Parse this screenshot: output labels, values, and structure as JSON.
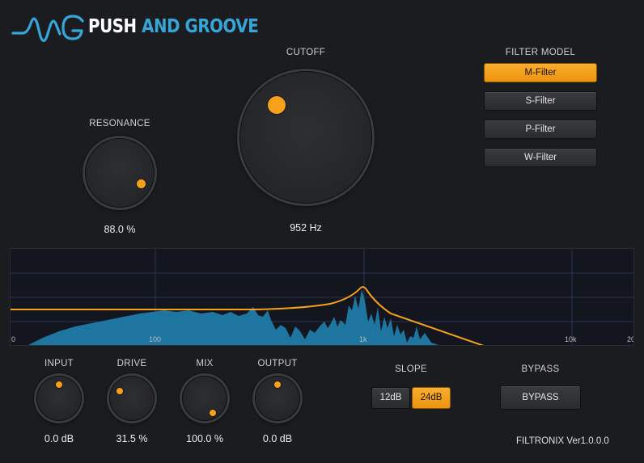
{
  "brand": {
    "logo_icon": "waveform-logo-icon",
    "name_part1": "PUSH",
    "name_part2": "AND GROOVE"
  },
  "colors": {
    "accent": "#f7a11a",
    "brand_blue": "#36a6d8",
    "background": "#1b1c1f"
  },
  "cutoff": {
    "label": "CUTOFF",
    "value": "952 Hz"
  },
  "resonance": {
    "label": "RESONANCE",
    "value": "88.0 %"
  },
  "filter_model": {
    "label": "FILTER MODEL",
    "options": [
      "M-Filter",
      "S-Filter",
      "P-Filter",
      "W-Filter"
    ],
    "selected": "M-Filter"
  },
  "display": {
    "x_ticks": [
      "0",
      "100",
      "1k",
      "10k",
      "20"
    ],
    "curve_color": "#f7a11a",
    "spectrum_color": "#1f7fae"
  },
  "knobs": [
    {
      "label": "INPUT",
      "value": "0.0 dB"
    },
    {
      "label": "DRIVE",
      "value": "31.5 %"
    },
    {
      "label": "MIX",
      "value": "100.0 %"
    },
    {
      "label": "OUTPUT",
      "value": "0.0 dB"
    }
  ],
  "slope": {
    "label": "SLOPE",
    "options": [
      "12dB",
      "24dB"
    ],
    "selected": "24dB"
  },
  "bypass": {
    "label": "BYPASS",
    "button_label": "BYPASS"
  },
  "version": "FILTRONIX Ver1.0.0.0"
}
